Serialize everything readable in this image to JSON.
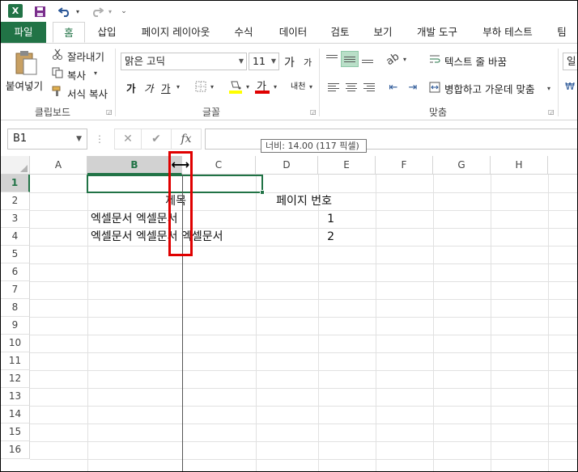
{
  "quick_access": {
    "app_icon": "excel-icon",
    "app_letter": "X",
    "items": [
      {
        "name": "save-icon",
        "glyph": "💾"
      },
      {
        "name": "undo-icon",
        "glyph": "↶"
      },
      {
        "name": "redo-icon",
        "glyph": "↷"
      },
      {
        "name": "customize-qat-icon",
        "glyph": "⌄"
      }
    ]
  },
  "tabs": [
    {
      "label": "파일",
      "state": "file"
    },
    {
      "label": "홈",
      "state": "active"
    },
    {
      "label": "삽입",
      "state": ""
    },
    {
      "label": "페이지 레이아웃",
      "state": ""
    },
    {
      "label": "수식",
      "state": ""
    },
    {
      "label": "데이터",
      "state": ""
    },
    {
      "label": "검토",
      "state": ""
    },
    {
      "label": "보기",
      "state": ""
    },
    {
      "label": "개발 도구",
      "state": ""
    },
    {
      "label": "부하 테스트",
      "state": ""
    },
    {
      "label": "팀",
      "state": ""
    }
  ],
  "ribbon": {
    "clipboard": {
      "label": "클립보드",
      "paste": "붙여넣기",
      "cut": "잘라내기",
      "copy": "복사",
      "format_painter": "서식 복사"
    },
    "font": {
      "label": "글꼴",
      "font_name": "맑은 고딕",
      "font_size": "11",
      "grow": "가",
      "shrink": "가",
      "bold": "가",
      "italic": "가",
      "underline": "가",
      "font_color_label": "가",
      "phonetic": "내천"
    },
    "alignment": {
      "label": "맞춤",
      "wrap_text": "텍스트 줄 바꿈",
      "merge_center": "병합하고 가운데 맞춤"
    },
    "number_partial": "일"
  },
  "formula_bar": {
    "name_box": "B1",
    "cancel": "✕",
    "enter": "✔",
    "fx": "fx",
    "value": ""
  },
  "tooltip": "너비: 14.00 (117 픽셀)",
  "sheet": {
    "columns": [
      "A",
      "B",
      "C",
      "D",
      "E",
      "F",
      "G",
      "H"
    ],
    "selected_column": "B",
    "rows": [
      "1",
      "2",
      "3",
      "4",
      "5",
      "6",
      "7",
      "8",
      "9",
      "10",
      "11",
      "12",
      "13",
      "14",
      "15",
      "16"
    ],
    "selected_row": "1",
    "cells": {
      "B2": "제목",
      "D2": "페이지 번호",
      "B3": "엑셀문서 엑셀문서",
      "D3": "1",
      "B4": "엑셀문서 엑셀문서 엑셀문서",
      "D4": "2"
    }
  },
  "colors": {
    "accent": "#217346",
    "highlight": "#e00000"
  }
}
